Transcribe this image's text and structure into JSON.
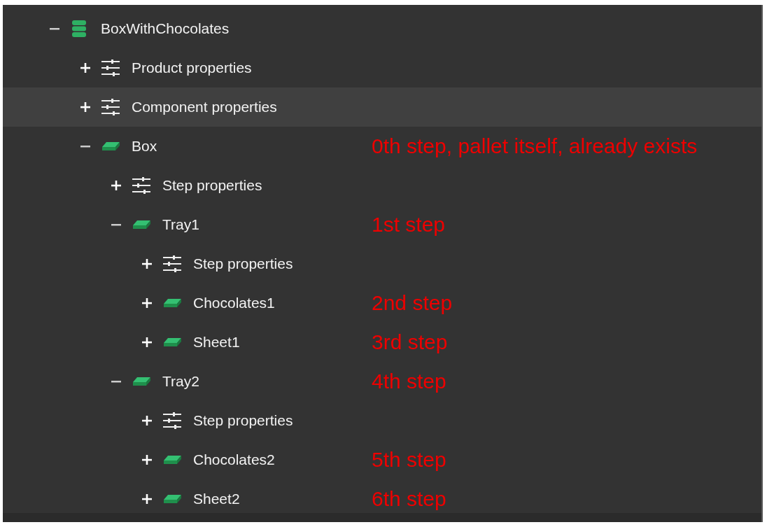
{
  "tree": [
    {
      "label": "BoxWithChocolates",
      "kind": "product",
      "expanded": true,
      "selected": false,
      "children": [
        {
          "label": "Product properties",
          "kind": "properties",
          "expanded": false,
          "selected": false
        },
        {
          "label": "Component properties",
          "kind": "properties",
          "expanded": false,
          "selected": true
        },
        {
          "label": "Box",
          "kind": "step",
          "expanded": true,
          "selected": false,
          "note": "0th step, pallet itself, already exists",
          "children": [
            {
              "label": "Step properties",
              "kind": "properties",
              "expanded": false,
              "selected": false
            },
            {
              "label": "Tray1",
              "kind": "step",
              "expanded": true,
              "selected": false,
              "note": "1st step",
              "children": [
                {
                  "label": "Step properties",
                  "kind": "properties",
                  "expanded": false,
                  "selected": false
                },
                {
                  "label": "Chocolates1",
                  "kind": "step",
                  "expanded": false,
                  "selected": false,
                  "note": "2nd step"
                },
                {
                  "label": "Sheet1",
                  "kind": "step",
                  "expanded": false,
                  "selected": false,
                  "note": "3rd step"
                }
              ]
            },
            {
              "label": "Tray2",
              "kind": "step",
              "expanded": true,
              "selected": false,
              "note": "4th step",
              "children": [
                {
                  "label": "Step properties",
                  "kind": "properties",
                  "expanded": false,
                  "selected": false
                },
                {
                  "label": "Chocolates2",
                  "kind": "step",
                  "expanded": false,
                  "selected": false,
                  "note": "5th step"
                },
                {
                  "label": "Sheet2",
                  "kind": "step",
                  "expanded": false,
                  "selected": false,
                  "note": "6th step"
                }
              ]
            }
          ]
        }
      ]
    }
  ]
}
